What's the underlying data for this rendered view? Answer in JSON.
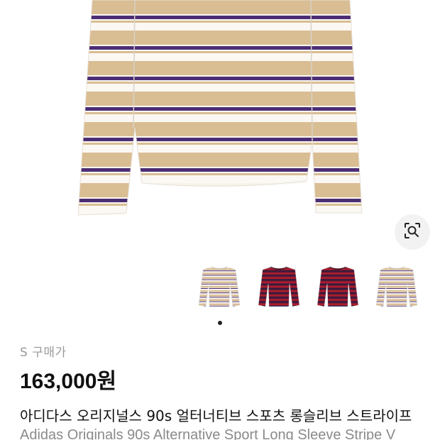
{
  "product": {
    "size_prefix": "S 구매가",
    "price": "163,000원",
    "title_ko": "아디다스 오리지널스 90s 얼터너티브 스포츠 롱슬리브 스트라이프",
    "title_en": "Adidas Originals 90s Alternative Sport Long Sleeve Stripe V"
  },
  "gallery": {
    "thumbnails": [
      {
        "colorway": "cream-beige-purple",
        "selected": true
      },
      {
        "colorway": "burgundy-red-navy",
        "selected": false
      },
      {
        "colorway": "burgundy-red-navy",
        "selected": false
      },
      {
        "colorway": "cream-beige-purple",
        "selected": false
      }
    ],
    "active_index": 1,
    "total": 4
  },
  "icons": {
    "lens": "image-search-icon"
  },
  "colors": {
    "cream": "#fbf8f3",
    "beige": "#d9bd93",
    "purple": "#4b2d74",
    "burgundy": "#5a1c3a",
    "red": "#b01d2a"
  }
}
